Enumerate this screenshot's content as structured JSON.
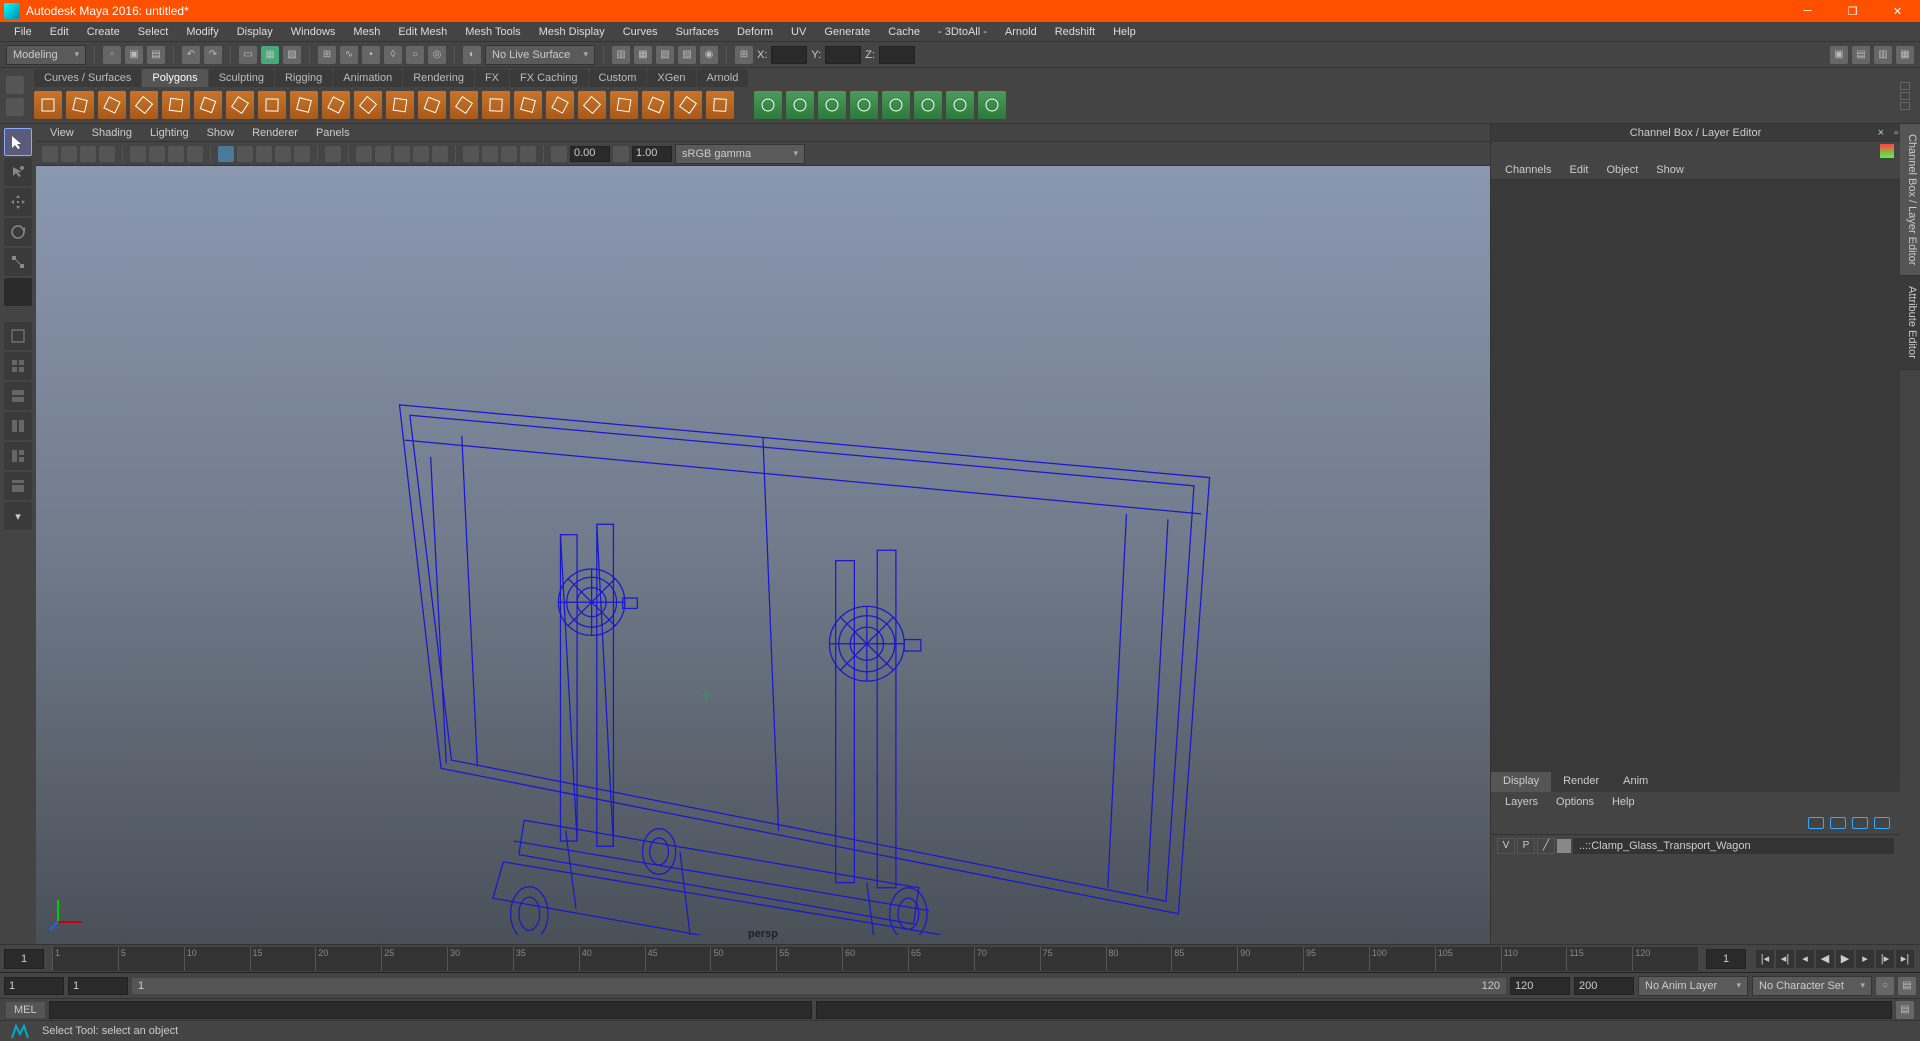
{
  "title": "Autodesk Maya 2016: untitled*",
  "menus": [
    "File",
    "Edit",
    "Create",
    "Select",
    "Modify",
    "Display",
    "Windows",
    "Mesh",
    "Edit Mesh",
    "Mesh Tools",
    "Mesh Display",
    "Curves",
    "Surfaces",
    "Deform",
    "UV",
    "Generate",
    "Cache",
    "- 3DtoAll -",
    "Arnold",
    "Redshift",
    "Help"
  ],
  "workspace": "Modeling",
  "liveSurface": "No Live Surface",
  "coords": {
    "x": "X:",
    "y": "Y:",
    "z": "Z:"
  },
  "shelfTabs": [
    "Curves / Surfaces",
    "Polygons",
    "Sculpting",
    "Rigging",
    "Animation",
    "Rendering",
    "FX",
    "FX Caching",
    "Custom",
    "XGen",
    "Arnold"
  ],
  "shelfActive": 1,
  "panelMenus": [
    "View",
    "Shading",
    "Lighting",
    "Show",
    "Renderer",
    "Panels"
  ],
  "panelNums": {
    "a": "0.00",
    "b": "1.00"
  },
  "colorMgmt": "sRGB gamma",
  "cameraLabel": "persp",
  "channelBox": {
    "header": "Channel Box / Layer Editor",
    "menus": [
      "Channels",
      "Edit",
      "Object",
      "Show"
    ]
  },
  "layerTabs": [
    "Display",
    "Render",
    "Anim"
  ],
  "layerActive": 0,
  "layerMenus": [
    "Layers",
    "Options",
    "Help"
  ],
  "layer": {
    "v": "V",
    "p": "P",
    "name": "..::Clamp_Glass_Transport_Wagon"
  },
  "sideTabs": [
    "Channel Box / Layer Editor",
    "Attribute Editor"
  ],
  "timeline": {
    "start": 1,
    "end": 120,
    "ticks": [
      1,
      5,
      10,
      15,
      20,
      25,
      30,
      35,
      40,
      45,
      50,
      55,
      60,
      65,
      70,
      75,
      80,
      85,
      90,
      95,
      100,
      105,
      110,
      115,
      120
    ]
  },
  "range": {
    "a": "1",
    "b": "1",
    "c": "1",
    "d": "120",
    "e": "120",
    "f": "200"
  },
  "animLayer": "No Anim Layer",
  "charSet": "No Character Set",
  "cmd": "MEL",
  "help": "Select Tool: select an object"
}
